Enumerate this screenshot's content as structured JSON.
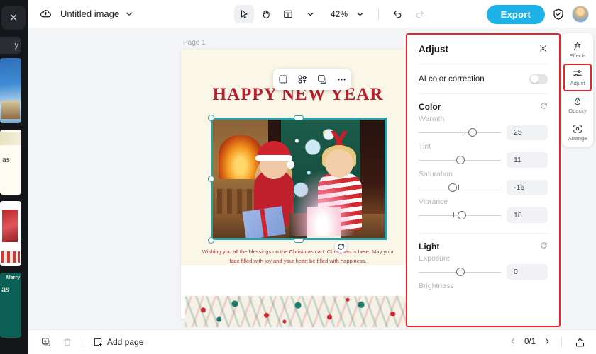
{
  "app": {
    "document_title": "Untitled image",
    "zoom_level": "42%",
    "export_label": "Export",
    "accent_blue": "#1eb3e8",
    "highlight_red": "#e8232a"
  },
  "topbar": {
    "cloud_icon": "cloud-save-icon",
    "title_caret_icon": "chevron-down-icon",
    "tools": [
      {
        "name": "select-tool",
        "icon": "cursor-arrow-icon",
        "active": true
      },
      {
        "name": "hand-tool",
        "icon": "hand-icon",
        "active": false
      },
      {
        "name": "layout-tool",
        "icon": "layout-panel-icon",
        "active": false
      },
      {
        "name": "layout-dropdown",
        "icon": "chevron-down-icon",
        "active": false
      }
    ],
    "zoom_caret_icon": "chevron-down-icon",
    "undo_icon": "undo-arrow-icon",
    "redo_icon": "redo-arrow-icon",
    "shield_icon": "shield-check-icon",
    "avatar_icon": "user-avatar"
  },
  "left_panel": {
    "close_icon": "close-x-icon",
    "pill_label": "y",
    "thumbnails": [
      {
        "name": "template-thumb-1"
      },
      {
        "name": "template-thumb-2"
      },
      {
        "name": "template-thumb-3"
      },
      {
        "name": "template-thumb-4"
      }
    ]
  },
  "canvas": {
    "page_label": "Page 1",
    "design": {
      "headline": "HAPPY NEW YEAR",
      "headline_color": "#b5202c",
      "background_color": "#faf6e8",
      "photo_alt": "two-children-opening-christmas-gifts-by-fireplace",
      "photo_border_color": "#2aa0a8",
      "caption": "Wishing you all the blessings on the Christmas cart. Christmas is here. May your face filled with joy and your heart be filled with happiness.",
      "pattern_band_alt": "christmas-reindeer-snowflake-pattern-border"
    },
    "float_toolbar": [
      {
        "name": "crop-image-button",
        "icon": "crop-frame-icon"
      },
      {
        "name": "remove-background-button",
        "icon": "remove-bg-icon"
      },
      {
        "name": "duplicate-button",
        "icon": "duplicate-layers-icon"
      },
      {
        "name": "more-options-button",
        "icon": "ellipsis-icon"
      }
    ],
    "rotate_handle_icon": "rotate-icon"
  },
  "adjust_panel": {
    "title": "Adjust",
    "close_icon": "close-x-icon",
    "ai_color_correction": {
      "label": "AI color correction",
      "enabled": false
    },
    "sections": [
      {
        "name": "color",
        "title": "Color",
        "reset_icon": "reset-circular-arrow-icon",
        "controls": [
          {
            "name": "warmth",
            "label": "Warmth",
            "value": "25",
            "knob_pct": 63,
            "tick_pct": 50
          },
          {
            "name": "tint",
            "label": "Tint",
            "value": "11",
            "knob_pct": 50,
            "tick_pct": 50
          },
          {
            "name": "saturation",
            "label": "Saturation",
            "value": "-16",
            "knob_pct": 42,
            "tick_pct": 55
          },
          {
            "name": "vibrance",
            "label": "Vibrance",
            "value": "18",
            "knob_pct": 53,
            "tick_pct": 45
          }
        ]
      },
      {
        "name": "light",
        "title": "Light",
        "reset_icon": "reset-circular-arrow-icon",
        "controls": [
          {
            "name": "exposure",
            "label": "Exposure",
            "value": "0",
            "knob_pct": 50,
            "tick_pct": -1
          },
          {
            "name": "brightness",
            "label": "Brightness",
            "value": "",
            "knob_pct": -1,
            "tick_pct": -1
          }
        ]
      }
    ]
  },
  "right_rail": {
    "items": [
      {
        "name": "effects",
        "label": "Effects",
        "icon": "magic-wand-star-icon",
        "selected": false
      },
      {
        "name": "adjust",
        "label": "Adjust",
        "icon": "sliders-icon",
        "selected": true
      },
      {
        "name": "opacity",
        "label": "Opacity",
        "icon": "droplet-icon",
        "selected": false
      },
      {
        "name": "arrange",
        "label": "Arrange",
        "icon": "arrange-frame-icon",
        "selected": false
      }
    ]
  },
  "bottombar": {
    "duplicate_page_icon": "duplicate-page-icon",
    "delete_page_icon": "trash-icon",
    "add_page_icon": "add-page-icon",
    "add_page_label": "Add page",
    "prev_icon": "chevron-left-icon",
    "page_counter": "0/1",
    "next_icon": "chevron-right-icon",
    "present_icon": "present-export-icon"
  }
}
